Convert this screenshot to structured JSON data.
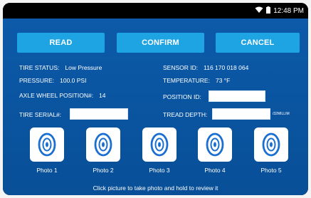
{
  "status": {
    "time": "12:48 PM",
    "icons": [
      "wifi-icon",
      "battery-icon"
    ]
  },
  "buttons": {
    "read": "READ",
    "confirm": "CONFIRM",
    "cancel": "CANCEL"
  },
  "info": {
    "tire_status_label": "TIRE STATUS:",
    "tire_status_value": "Low Pressure",
    "pressure_label": "PRESSURE:",
    "pressure_value": "100.0 PSI",
    "axle_wheel_label": "AXLE WHEEL POSITION#:",
    "axle_wheel_value": "14",
    "sensor_id_label": "SENSOR ID:",
    "sensor_id_value": "116 170 018 064",
    "temperature_label": "TEMPERATURE:",
    "temperature_value": "73 °F",
    "position_id_label": "POSITION ID:",
    "position_id_value": "",
    "tire_serial_label": "TIRE SERIAL#:",
    "tire_serial_value": "",
    "tread_depth_label": "TREAD DEPTH:",
    "tread_depth_value": "",
    "tread_depth_unit": "/32MILLIM"
  },
  "photos": [
    {
      "label": "Photo 1"
    },
    {
      "label": "Photo 2"
    },
    {
      "label": "Photo 3"
    },
    {
      "label": "Photo 4"
    },
    {
      "label": "Photo 5"
    }
  ],
  "hint": "Click picture to take photo and hold to review it",
  "colors": {
    "background": "#0b57a6",
    "button": "#1ea3e3",
    "icon": "#1b6fd0"
  }
}
